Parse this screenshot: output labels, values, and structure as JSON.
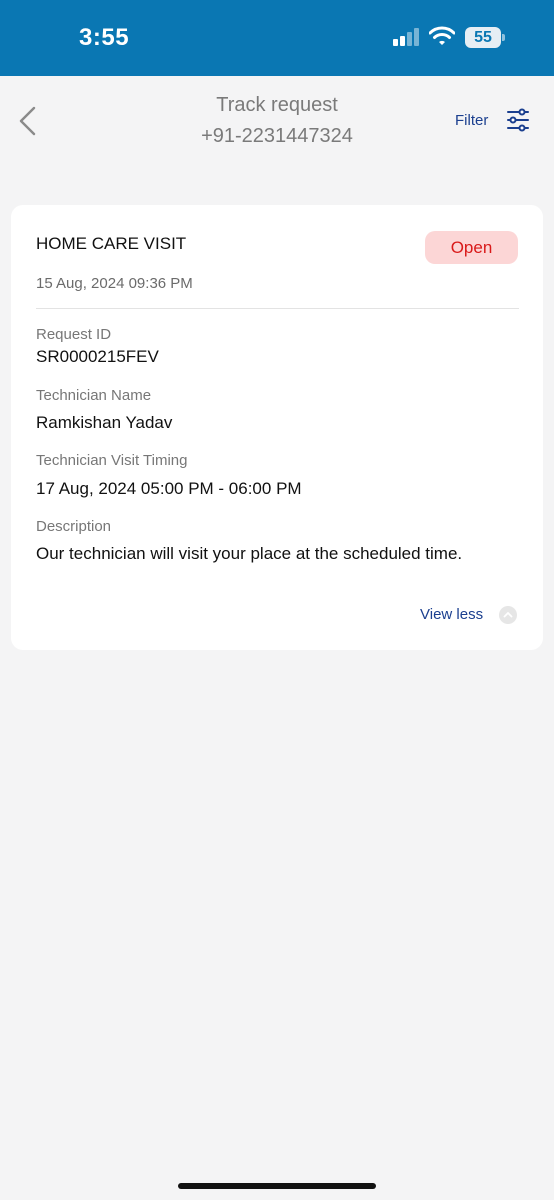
{
  "status_bar": {
    "time": "3:55",
    "battery": "55",
    "signal_icon": "cellular-signal-icon",
    "wifi_icon": "wifi-icon"
  },
  "header": {
    "title": "Track request",
    "subtitle": "+91-2231447324",
    "filter_label": "Filter",
    "back_icon": "chevron-left-icon",
    "filter_icon": "sliders-icon"
  },
  "request_card": {
    "title": "HOME CARE VISIT",
    "status": "Open",
    "created_at": "15 Aug, 2024 09:36 PM",
    "fields": [
      {
        "label": "Request ID",
        "value": "SR0000215FEV"
      },
      {
        "label": "Technician Name",
        "value": "Ramkishan Yadav"
      },
      {
        "label": "Technician Visit Timing",
        "value": "17 Aug, 2024 05:00 PM - 06:00 PM"
      },
      {
        "label": "Description",
        "value": "Our technician will visit your place at the scheduled time."
      }
    ],
    "toggle_label": "View less",
    "toggle_icon": "chevron-up-circle-icon"
  },
  "colors": {
    "status_bar_bg": "#0a77b3",
    "accent_link": "#1b3f8f",
    "badge_bg": "#fcd6d6",
    "badge_text": "#d91a1a",
    "page_bg": "#f4f4f5"
  }
}
